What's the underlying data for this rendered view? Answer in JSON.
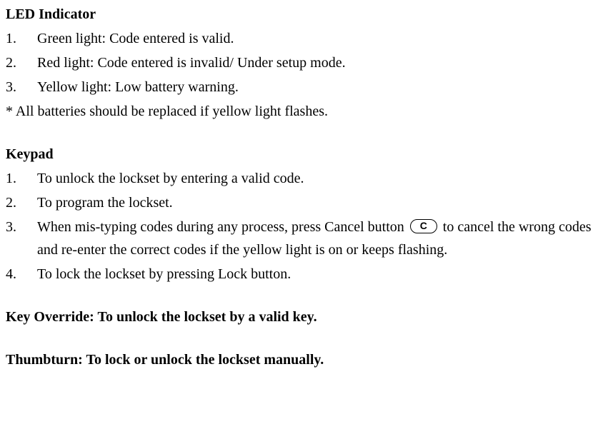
{
  "led": {
    "heading": "LED Indicator",
    "items": [
      {
        "num": "1.",
        "text": "Green light: Code entered is valid."
      },
      {
        "num": "2.",
        "text": "Red light: Code entered is invalid/ Under setup mode."
      },
      {
        "num": "3.",
        "text": "Yellow light: Low battery warning."
      }
    ],
    "note": "* All batteries should be replaced if yellow light flashes."
  },
  "keypad": {
    "heading": "Keypad",
    "items": [
      {
        "num": "1.",
        "text": "To unlock the lockset by entering a valid code."
      },
      {
        "num": "2.",
        "text": "To program the lockset."
      },
      {
        "num": "3.",
        "before": "When mis-typing codes during any process, press Cancel button ",
        "icon": "C",
        "after": " to cancel the wrong codes and re-enter the correct codes if the yellow light is on or keeps flashing."
      },
      {
        "num": "4.",
        "text": "To lock the lockset by pressing Lock button."
      }
    ]
  },
  "keyoverride": {
    "heading": "Key Override: To unlock the lockset by a valid key."
  },
  "thumbturn": {
    "heading": "Thumbturn: To lock or unlock the lockset manually."
  }
}
